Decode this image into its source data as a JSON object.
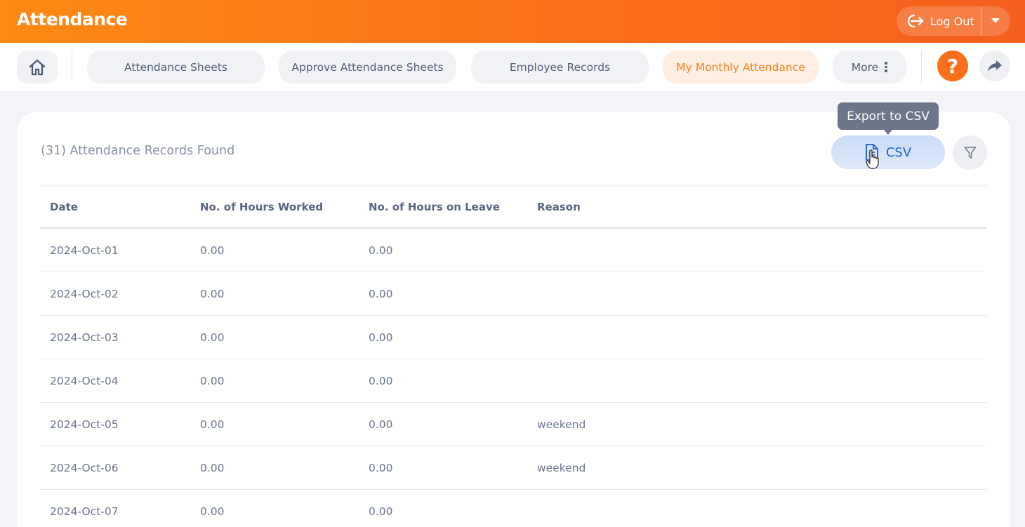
{
  "header": {
    "title": "Attendance",
    "logout_label": "Log Out",
    "accent": "#fa6d1a"
  },
  "nav": {
    "items": [
      {
        "label": "Attendance Sheets",
        "active": false
      },
      {
        "label": "Approve Attendance Sheets",
        "active": false
      },
      {
        "label": "Employee Records",
        "active": false
      },
      {
        "label": "My Monthly Attendance",
        "active": true
      }
    ],
    "more_label": "More",
    "help_symbol": "?",
    "icons": {
      "home": "home-icon",
      "more": "vertical-dots-icon",
      "help": "question-icon",
      "share": "share-arrow-icon"
    }
  },
  "main": {
    "records_count": "(31) Attendance Records Found",
    "csv_label": "CSV",
    "tooltip": "Export to CSV",
    "columns": [
      "Date",
      "No. of Hours Worked",
      "No. of Hours on Leave",
      "Reason"
    ],
    "rows": [
      [
        "2024-Oct-01",
        "0.00",
        "0.00",
        ""
      ],
      [
        "2024-Oct-02",
        "0.00",
        "0.00",
        ""
      ],
      [
        "2024-Oct-03",
        "0.00",
        "0.00",
        ""
      ],
      [
        "2024-Oct-04",
        "0.00",
        "0.00",
        ""
      ],
      [
        "2024-Oct-05",
        "0.00",
        "0.00",
        "weekend"
      ],
      [
        "2024-Oct-06",
        "0.00",
        "0.00",
        "weekend"
      ],
      [
        "2024-Oct-07",
        "0.00",
        "0.00",
        ""
      ]
    ]
  }
}
